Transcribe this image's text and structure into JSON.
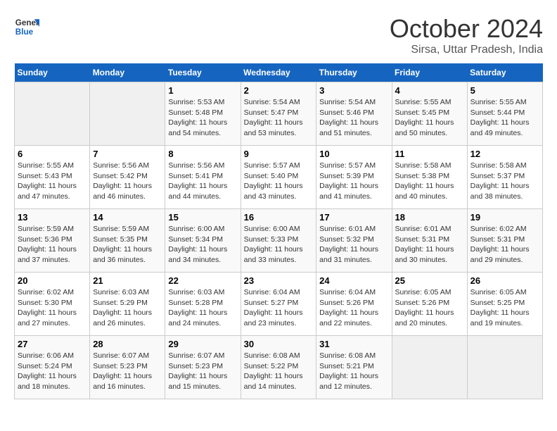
{
  "header": {
    "logo_line1": "General",
    "logo_line2": "Blue",
    "title": "October 2024",
    "subtitle": "Sirsa, Uttar Pradesh, India"
  },
  "weekdays": [
    "Sunday",
    "Monday",
    "Tuesday",
    "Wednesday",
    "Thursday",
    "Friday",
    "Saturday"
  ],
  "weeks": [
    [
      {
        "day": "",
        "detail": ""
      },
      {
        "day": "",
        "detail": ""
      },
      {
        "day": "1",
        "detail": "Sunrise: 5:53 AM\nSunset: 5:48 PM\nDaylight: 11 hours and 54 minutes."
      },
      {
        "day": "2",
        "detail": "Sunrise: 5:54 AM\nSunset: 5:47 PM\nDaylight: 11 hours and 53 minutes."
      },
      {
        "day": "3",
        "detail": "Sunrise: 5:54 AM\nSunset: 5:46 PM\nDaylight: 11 hours and 51 minutes."
      },
      {
        "day": "4",
        "detail": "Sunrise: 5:55 AM\nSunset: 5:45 PM\nDaylight: 11 hours and 50 minutes."
      },
      {
        "day": "5",
        "detail": "Sunrise: 5:55 AM\nSunset: 5:44 PM\nDaylight: 11 hours and 49 minutes."
      }
    ],
    [
      {
        "day": "6",
        "detail": "Sunrise: 5:55 AM\nSunset: 5:43 PM\nDaylight: 11 hours and 47 minutes."
      },
      {
        "day": "7",
        "detail": "Sunrise: 5:56 AM\nSunset: 5:42 PM\nDaylight: 11 hours and 46 minutes."
      },
      {
        "day": "8",
        "detail": "Sunrise: 5:56 AM\nSunset: 5:41 PM\nDaylight: 11 hours and 44 minutes."
      },
      {
        "day": "9",
        "detail": "Sunrise: 5:57 AM\nSunset: 5:40 PM\nDaylight: 11 hours and 43 minutes."
      },
      {
        "day": "10",
        "detail": "Sunrise: 5:57 AM\nSunset: 5:39 PM\nDaylight: 11 hours and 41 minutes."
      },
      {
        "day": "11",
        "detail": "Sunrise: 5:58 AM\nSunset: 5:38 PM\nDaylight: 11 hours and 40 minutes."
      },
      {
        "day": "12",
        "detail": "Sunrise: 5:58 AM\nSunset: 5:37 PM\nDaylight: 11 hours and 38 minutes."
      }
    ],
    [
      {
        "day": "13",
        "detail": "Sunrise: 5:59 AM\nSunset: 5:36 PM\nDaylight: 11 hours and 37 minutes."
      },
      {
        "day": "14",
        "detail": "Sunrise: 5:59 AM\nSunset: 5:35 PM\nDaylight: 11 hours and 36 minutes."
      },
      {
        "day": "15",
        "detail": "Sunrise: 6:00 AM\nSunset: 5:34 PM\nDaylight: 11 hours and 34 minutes."
      },
      {
        "day": "16",
        "detail": "Sunrise: 6:00 AM\nSunset: 5:33 PM\nDaylight: 11 hours and 33 minutes."
      },
      {
        "day": "17",
        "detail": "Sunrise: 6:01 AM\nSunset: 5:32 PM\nDaylight: 11 hours and 31 minutes."
      },
      {
        "day": "18",
        "detail": "Sunrise: 6:01 AM\nSunset: 5:31 PM\nDaylight: 11 hours and 30 minutes."
      },
      {
        "day": "19",
        "detail": "Sunrise: 6:02 AM\nSunset: 5:31 PM\nDaylight: 11 hours and 29 minutes."
      }
    ],
    [
      {
        "day": "20",
        "detail": "Sunrise: 6:02 AM\nSunset: 5:30 PM\nDaylight: 11 hours and 27 minutes."
      },
      {
        "day": "21",
        "detail": "Sunrise: 6:03 AM\nSunset: 5:29 PM\nDaylight: 11 hours and 26 minutes."
      },
      {
        "day": "22",
        "detail": "Sunrise: 6:03 AM\nSunset: 5:28 PM\nDaylight: 11 hours and 24 minutes."
      },
      {
        "day": "23",
        "detail": "Sunrise: 6:04 AM\nSunset: 5:27 PM\nDaylight: 11 hours and 23 minutes."
      },
      {
        "day": "24",
        "detail": "Sunrise: 6:04 AM\nSunset: 5:26 PM\nDaylight: 11 hours and 22 minutes."
      },
      {
        "day": "25",
        "detail": "Sunrise: 6:05 AM\nSunset: 5:26 PM\nDaylight: 11 hours and 20 minutes."
      },
      {
        "day": "26",
        "detail": "Sunrise: 6:05 AM\nSunset: 5:25 PM\nDaylight: 11 hours and 19 minutes."
      }
    ],
    [
      {
        "day": "27",
        "detail": "Sunrise: 6:06 AM\nSunset: 5:24 PM\nDaylight: 11 hours and 18 minutes."
      },
      {
        "day": "28",
        "detail": "Sunrise: 6:07 AM\nSunset: 5:23 PM\nDaylight: 11 hours and 16 minutes."
      },
      {
        "day": "29",
        "detail": "Sunrise: 6:07 AM\nSunset: 5:23 PM\nDaylight: 11 hours and 15 minutes."
      },
      {
        "day": "30",
        "detail": "Sunrise: 6:08 AM\nSunset: 5:22 PM\nDaylight: 11 hours and 14 minutes."
      },
      {
        "day": "31",
        "detail": "Sunrise: 6:08 AM\nSunset: 5:21 PM\nDaylight: 11 hours and 12 minutes."
      },
      {
        "day": "",
        "detail": ""
      },
      {
        "day": "",
        "detail": ""
      }
    ]
  ]
}
